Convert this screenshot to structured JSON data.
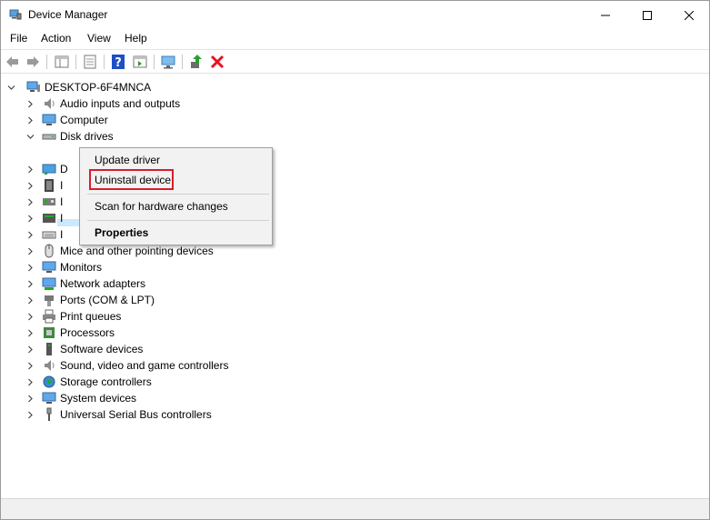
{
  "window": {
    "title": "Device Manager"
  },
  "menu": [
    "File",
    "Action",
    "View",
    "Help"
  ],
  "tree": {
    "root": "DESKTOP-6F4MNCA",
    "items": [
      "Audio inputs and outputs",
      "Computer",
      "Disk drives",
      "Mice and other pointing devices",
      "Monitors",
      "Network adapters",
      "Ports (COM & LPT)",
      "Print queues",
      "Processors",
      "Software devices",
      "Sound, video and game controllers",
      "Storage controllers",
      "System devices",
      "Universal Serial Bus controllers"
    ],
    "obscured_partial_letters": [
      "D",
      "I",
      "I",
      "I",
      "I"
    ]
  },
  "context_menu": {
    "update_driver": "Update driver",
    "uninstall_device": "Uninstall device",
    "scan_hardware": "Scan for hardware changes",
    "properties": "Properties"
  },
  "colors": {
    "highlight": "#d81e2a",
    "selection": "#cce8ff",
    "uninstall_icon": "#e81123",
    "help_icon": "#1e4fc4"
  }
}
